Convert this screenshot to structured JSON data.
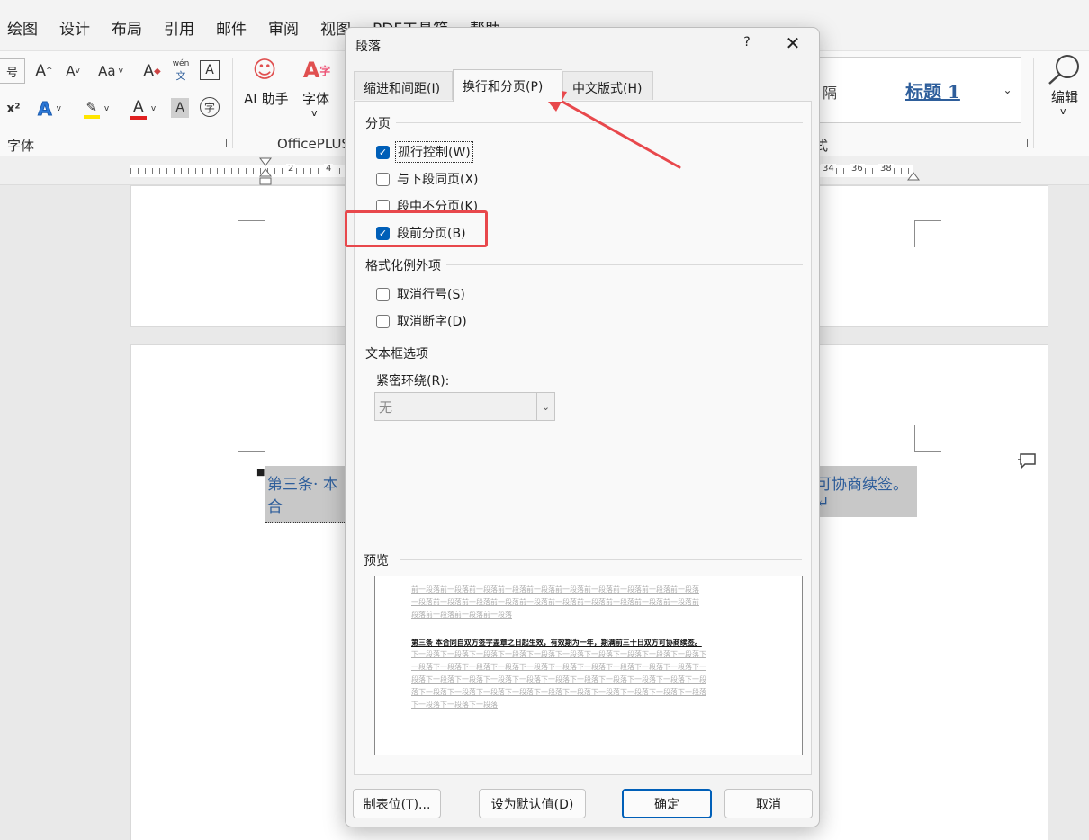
{
  "menu": [
    "绘图",
    "设计",
    "布局",
    "引用",
    "邮件",
    "审阅",
    "视图",
    "PDF工具箱",
    "帮助"
  ],
  "ribbon": {
    "font_group_label": "字体",
    "officeplus_label": "OfficePLUS",
    "ai_assistant": "AI 助手",
    "font_button": "字体",
    "styles_partial": "隔",
    "style_heading": "标题 1",
    "styles_group_label_partial": "式",
    "edit_label": "编辑",
    "wen_label": "wén",
    "wen_char": "文",
    "phonetic_char": "字",
    "a_char": "A",
    "change_case": "Aa",
    "superscript": "x²"
  },
  "ruler": {
    "left_numbers": [
      "2",
      "4"
    ],
    "right_numbers": [
      "34",
      "36",
      "38"
    ]
  },
  "document": {
    "paragraph_left": "第三条· 本合",
    "paragraph_right": "可协商续签。↵"
  },
  "dialog": {
    "title": "段落",
    "help": "?",
    "close": "✕",
    "tabs": [
      {
        "label": "缩进和间距(I)",
        "active": false
      },
      {
        "label": "换行和分页(P)",
        "active": true
      },
      {
        "label": "中文版式(H)",
        "active": false
      }
    ],
    "pagination": {
      "heading": "分页",
      "options": [
        {
          "label": "孤行控制(W)",
          "checked": true
        },
        {
          "label": "与下段同页(X)",
          "checked": false
        },
        {
          "label": "段中不分页(K)",
          "checked": false
        },
        {
          "label": "段前分页(B)",
          "checked": true
        }
      ]
    },
    "formatting": {
      "heading": "格式化例外项",
      "options": [
        {
          "label": "取消行号(S)",
          "checked": false
        },
        {
          "label": "取消断字(D)",
          "checked": false
        }
      ]
    },
    "textbox": {
      "heading": "文本框选项",
      "tight_wrap_label": "紧密环绕(R):",
      "tight_wrap_value": "无"
    },
    "preview": {
      "heading": "预览",
      "prev_line_1": "前一段落前一段落前一段落前一段落前一段落前一段落前一段落前一段落前一段落前一段落",
      "prev_line_2": "一段落前一段落前一段落前一段落前一段落前一段落前一段落前一段落前一段落前一段落前",
      "prev_line_3": "段落前一段落前一段落前一段落",
      "main_text": "第三条 本合同自双方签字盖章之日起生效，有效期为一年，期满前三十日双方可协商续签。",
      "next_line_1": "下一段落下一段落下一段落下一段落下一段落下一段落下一段落下一段落下一段落下一段落下",
      "next_line_2": "一段落下一段落下一段落下一段落下一段落下一段落下一段落下一段落下一段落下一段落下一",
      "next_line_3": "段落下一段落下一段落下一段落下一段落下一段落下一段落下一段落下一段落下一段落下一段",
      "next_line_4": "落下一段落下一段落下一段落下一段落下一段落下一段落下一段落下一段落下一段落下一段落",
      "next_line_5": "下一段落下一段落下一段落"
    },
    "buttons": {
      "tabs": "制表位(T)...",
      "set_default": "设为默认值(D)",
      "ok": "确定",
      "cancel": "取消"
    }
  },
  "annotation_color": "#e8484c",
  "accent_color": "#005fb8"
}
